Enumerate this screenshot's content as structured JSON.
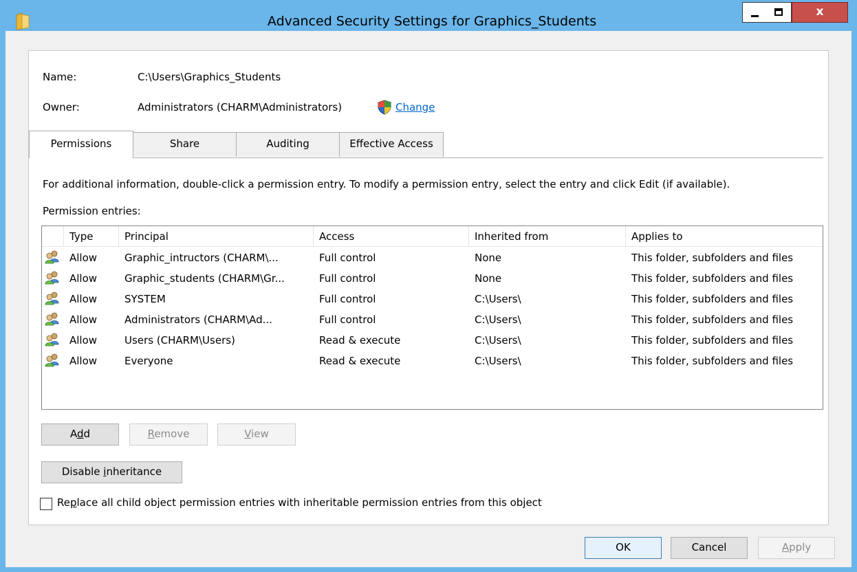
{
  "window": {
    "title": "Advanced Security Settings for Graphics_Students",
    "close_glyph": "x"
  },
  "info": {
    "name_label": "Name:",
    "name_value": "C:\\Users\\Graphics_Students",
    "owner_label": "Owner:",
    "owner_value": "Administrators (CHARM\\Administrators)",
    "change_link": "Change"
  },
  "tabs": [
    {
      "label": "Permissions",
      "active": true
    },
    {
      "label": "Share",
      "active": false
    },
    {
      "label": "Auditing",
      "active": false
    },
    {
      "label": "Effective Access",
      "active": false
    }
  ],
  "permissions": {
    "info_text": "For additional information, double-click a permission entry. To modify a permission entry, select the entry and click Edit (if available).",
    "entries_label": "Permission entries:",
    "columns": [
      "Type",
      "Principal",
      "Access",
      "Inherited from",
      "Applies to"
    ],
    "rows": [
      {
        "icon": "users-group-icon",
        "type": "Allow",
        "principal": "Graphic_intructors (CHARM\\...",
        "access": "Full control",
        "inherited": "None",
        "applies": "This folder, subfolders and files"
      },
      {
        "icon": "users-group-icon",
        "type": "Allow",
        "principal": "Graphic_students (CHARM\\Gr...",
        "access": "Full control",
        "inherited": "None",
        "applies": "This folder, subfolders and files"
      },
      {
        "icon": "users-group-icon",
        "type": "Allow",
        "principal": "SYSTEM",
        "access": "Full control",
        "inherited": "C:\\Users\\",
        "applies": "This folder, subfolders and files"
      },
      {
        "icon": "users-group-icon",
        "type": "Allow",
        "principal": "Administrators (CHARM\\Ad...",
        "access": "Full control",
        "inherited": "C:\\Users\\",
        "applies": "This folder, subfolders and files"
      },
      {
        "icon": "users-group-icon",
        "type": "Allow",
        "principal": "Users (CHARM\\Users)",
        "access": "Read & execute",
        "inherited": "C:\\Users\\",
        "applies": "This folder, subfolders and files"
      },
      {
        "icon": "users-group-icon",
        "type": "Allow",
        "principal": "Everyone",
        "access": "Read & execute",
        "inherited": "C:\\Users\\",
        "applies": "This folder, subfolders and files"
      }
    ]
  },
  "buttons": {
    "add": {
      "pre": "A",
      "key": "d",
      "post": "d"
    },
    "remove": {
      "pre": "",
      "key": "R",
      "post": "emove"
    },
    "view": {
      "pre": "",
      "key": "V",
      "post": "iew"
    },
    "disable_inheritance": {
      "pre": "Disable ",
      "key": "i",
      "post": "nheritance"
    },
    "ok": "OK",
    "cancel": "Cancel",
    "apply": {
      "pre": "",
      "key": "A",
      "post": "pply"
    }
  },
  "replace_checkbox": {
    "pre": "Re",
    "key": "p",
    "post": "lace all child object permission entries with inheritable permission entries from this object",
    "checked": false
  }
}
